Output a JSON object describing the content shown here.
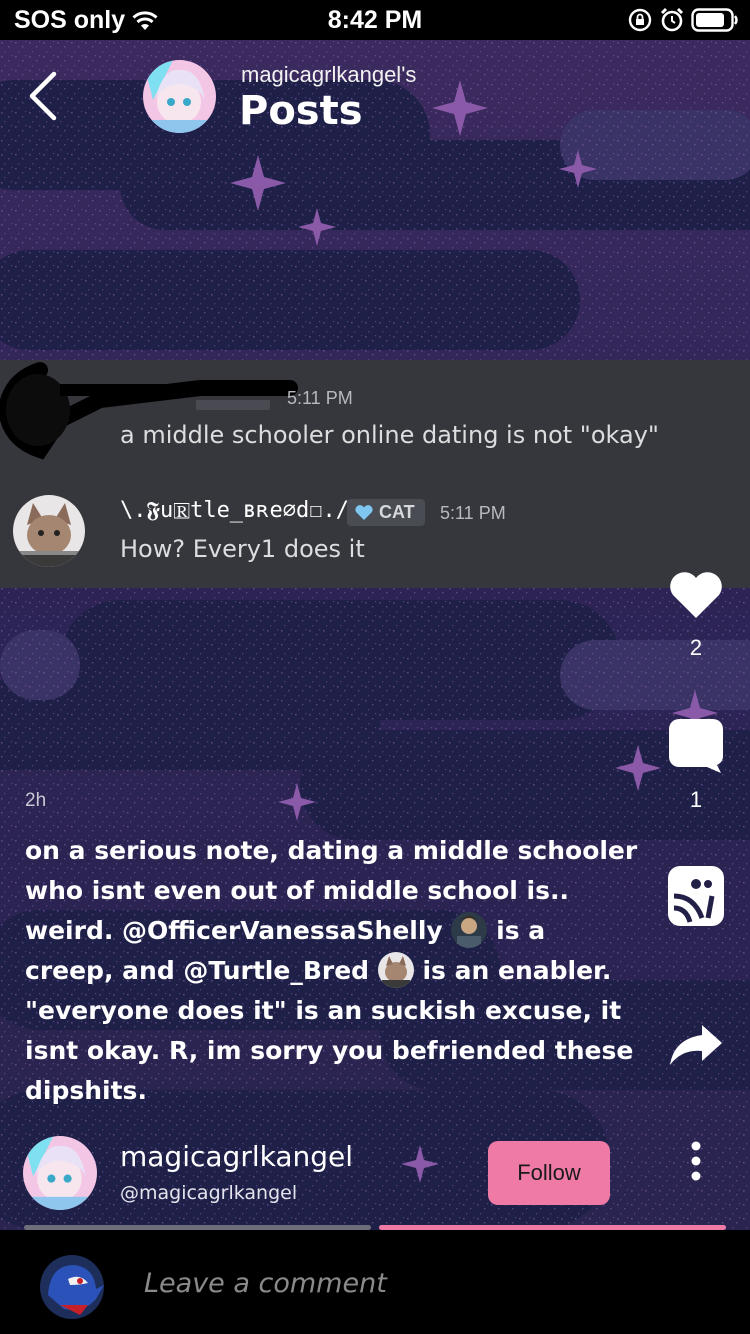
{
  "status_bar": {
    "carrier": "SOS only",
    "time": "8:42 PM",
    "icons": [
      "wifi-icon",
      "orientation-lock-icon",
      "alarm-icon",
      "battery-icon"
    ]
  },
  "header": {
    "owner": "magicagrlkangel's",
    "title": "Posts",
    "back_icon": "chevron-left-icon"
  },
  "screenshot": {
    "message1": {
      "time": "5:11 PM",
      "text": "a middle schooler online dating is not \"okay\""
    },
    "message2": {
      "username": "\\.𝕱u🅁tle_ʙʀe∅d☐./",
      "tag": "CAT",
      "time": "5:11 PM",
      "text": "How? Every1 does it"
    }
  },
  "actions": {
    "like_count": "2",
    "comment_count": "1",
    "icons": [
      "heart-icon",
      "comment-icon",
      "amino-share-icon",
      "share-arrow-icon"
    ]
  },
  "post": {
    "age": "2h",
    "lines": [
      "on a serious note, dating a middle schooler",
      "who isnt even out of middle school is..",
      [
        "weird. @OfficerVanessaShelly ",
        " is a"
      ],
      [
        "creep, and @Turtle_Bred ",
        " is an enabler."
      ],
      "\"everyone does it\" is an suckish excuse, it",
      "isnt okay. R, im sorry you befriended these",
      "dipshits."
    ]
  },
  "author": {
    "name": "magicagrlkangel",
    "handle": "@magicagrlkangel",
    "follow_label": "Follow"
  },
  "progress": {
    "segments": 2,
    "active_segment": 2
  },
  "comment_bar": {
    "placeholder": "Leave a comment"
  },
  "colors": {
    "accent": "#f07aa6",
    "background": "#232048",
    "chat_bg": "#36373d"
  }
}
